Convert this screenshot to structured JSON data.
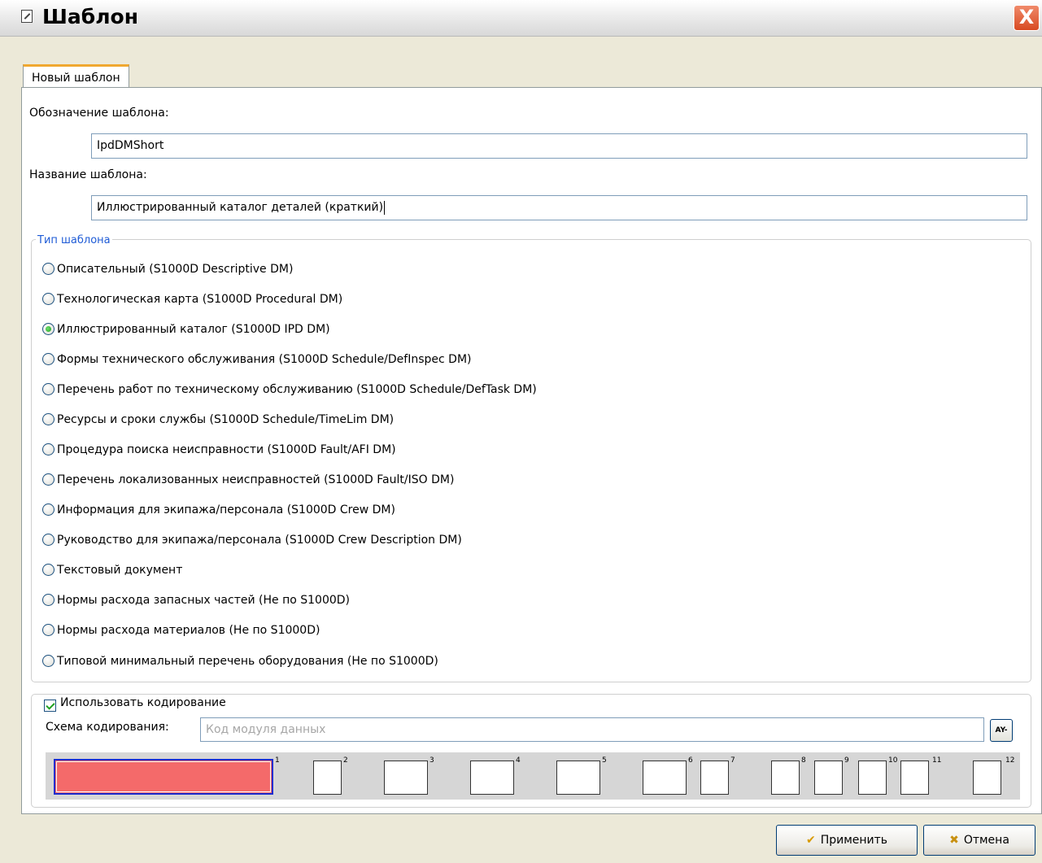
{
  "window": {
    "title": "Шаблон"
  },
  "tabs": [
    {
      "label": "Новый шаблон"
    }
  ],
  "designation": {
    "label": "Обозначение шаблона:",
    "value": "IpdDMShort"
  },
  "name": {
    "label": "Название шаблона:",
    "value": "Иллюстрированный каталог деталей (краткий)"
  },
  "type_group": {
    "legend": "Тип шаблона",
    "selected_index": 2,
    "options": [
      "Описательный (S1000D Descriptive DM)",
      "Технологическая карта (S1000D Procedural DM)",
      "Иллюстрированный каталог (S1000D IPD DM)",
      "Формы технического обслуживания (S1000D Schedule/DefInspec DM)",
      "Перечень работ по техническому обслуживанию (S1000D Schedule/DefTask DM)",
      "Ресурсы и сроки службы (S1000D Schedule/TimeLim DM)",
      "Процедура поиска неисправности (S1000D Fault/AFI DM)",
      "Перечень локализованных неисправностей (S1000D Fault/ISO DM)",
      "Информация для экипажа/персонала (S1000D Crew DM)",
      "Руководство для экипажа/персонала (S1000D Crew Description DM)",
      "Текстовый документ",
      "Нормы расхода запасных частей (Не по S1000D)",
      "Нормы расхода материалов (Не по S1000D)",
      "Типовой минимальный перечень оборудования (Не по S1000D)"
    ]
  },
  "coding": {
    "use_label": "Использовать кодирование",
    "use_checked": true,
    "scheme_label": "Схема кодирования:",
    "scheme_placeholder": "Код модуля данных",
    "scheme_button": "AY-",
    "segment_numbers": [
      "1",
      "2",
      "3",
      "4",
      "5",
      "6",
      "7",
      "8",
      "9",
      "10",
      "11",
      "12"
    ],
    "first_segment_color": "#f46a6a"
  },
  "buttons": {
    "apply": "Применить",
    "cancel": "Отмена",
    "close": "X"
  },
  "colors": {
    "legend": "#1e5bd6",
    "check": "#21a121",
    "close": "#d84a22"
  }
}
